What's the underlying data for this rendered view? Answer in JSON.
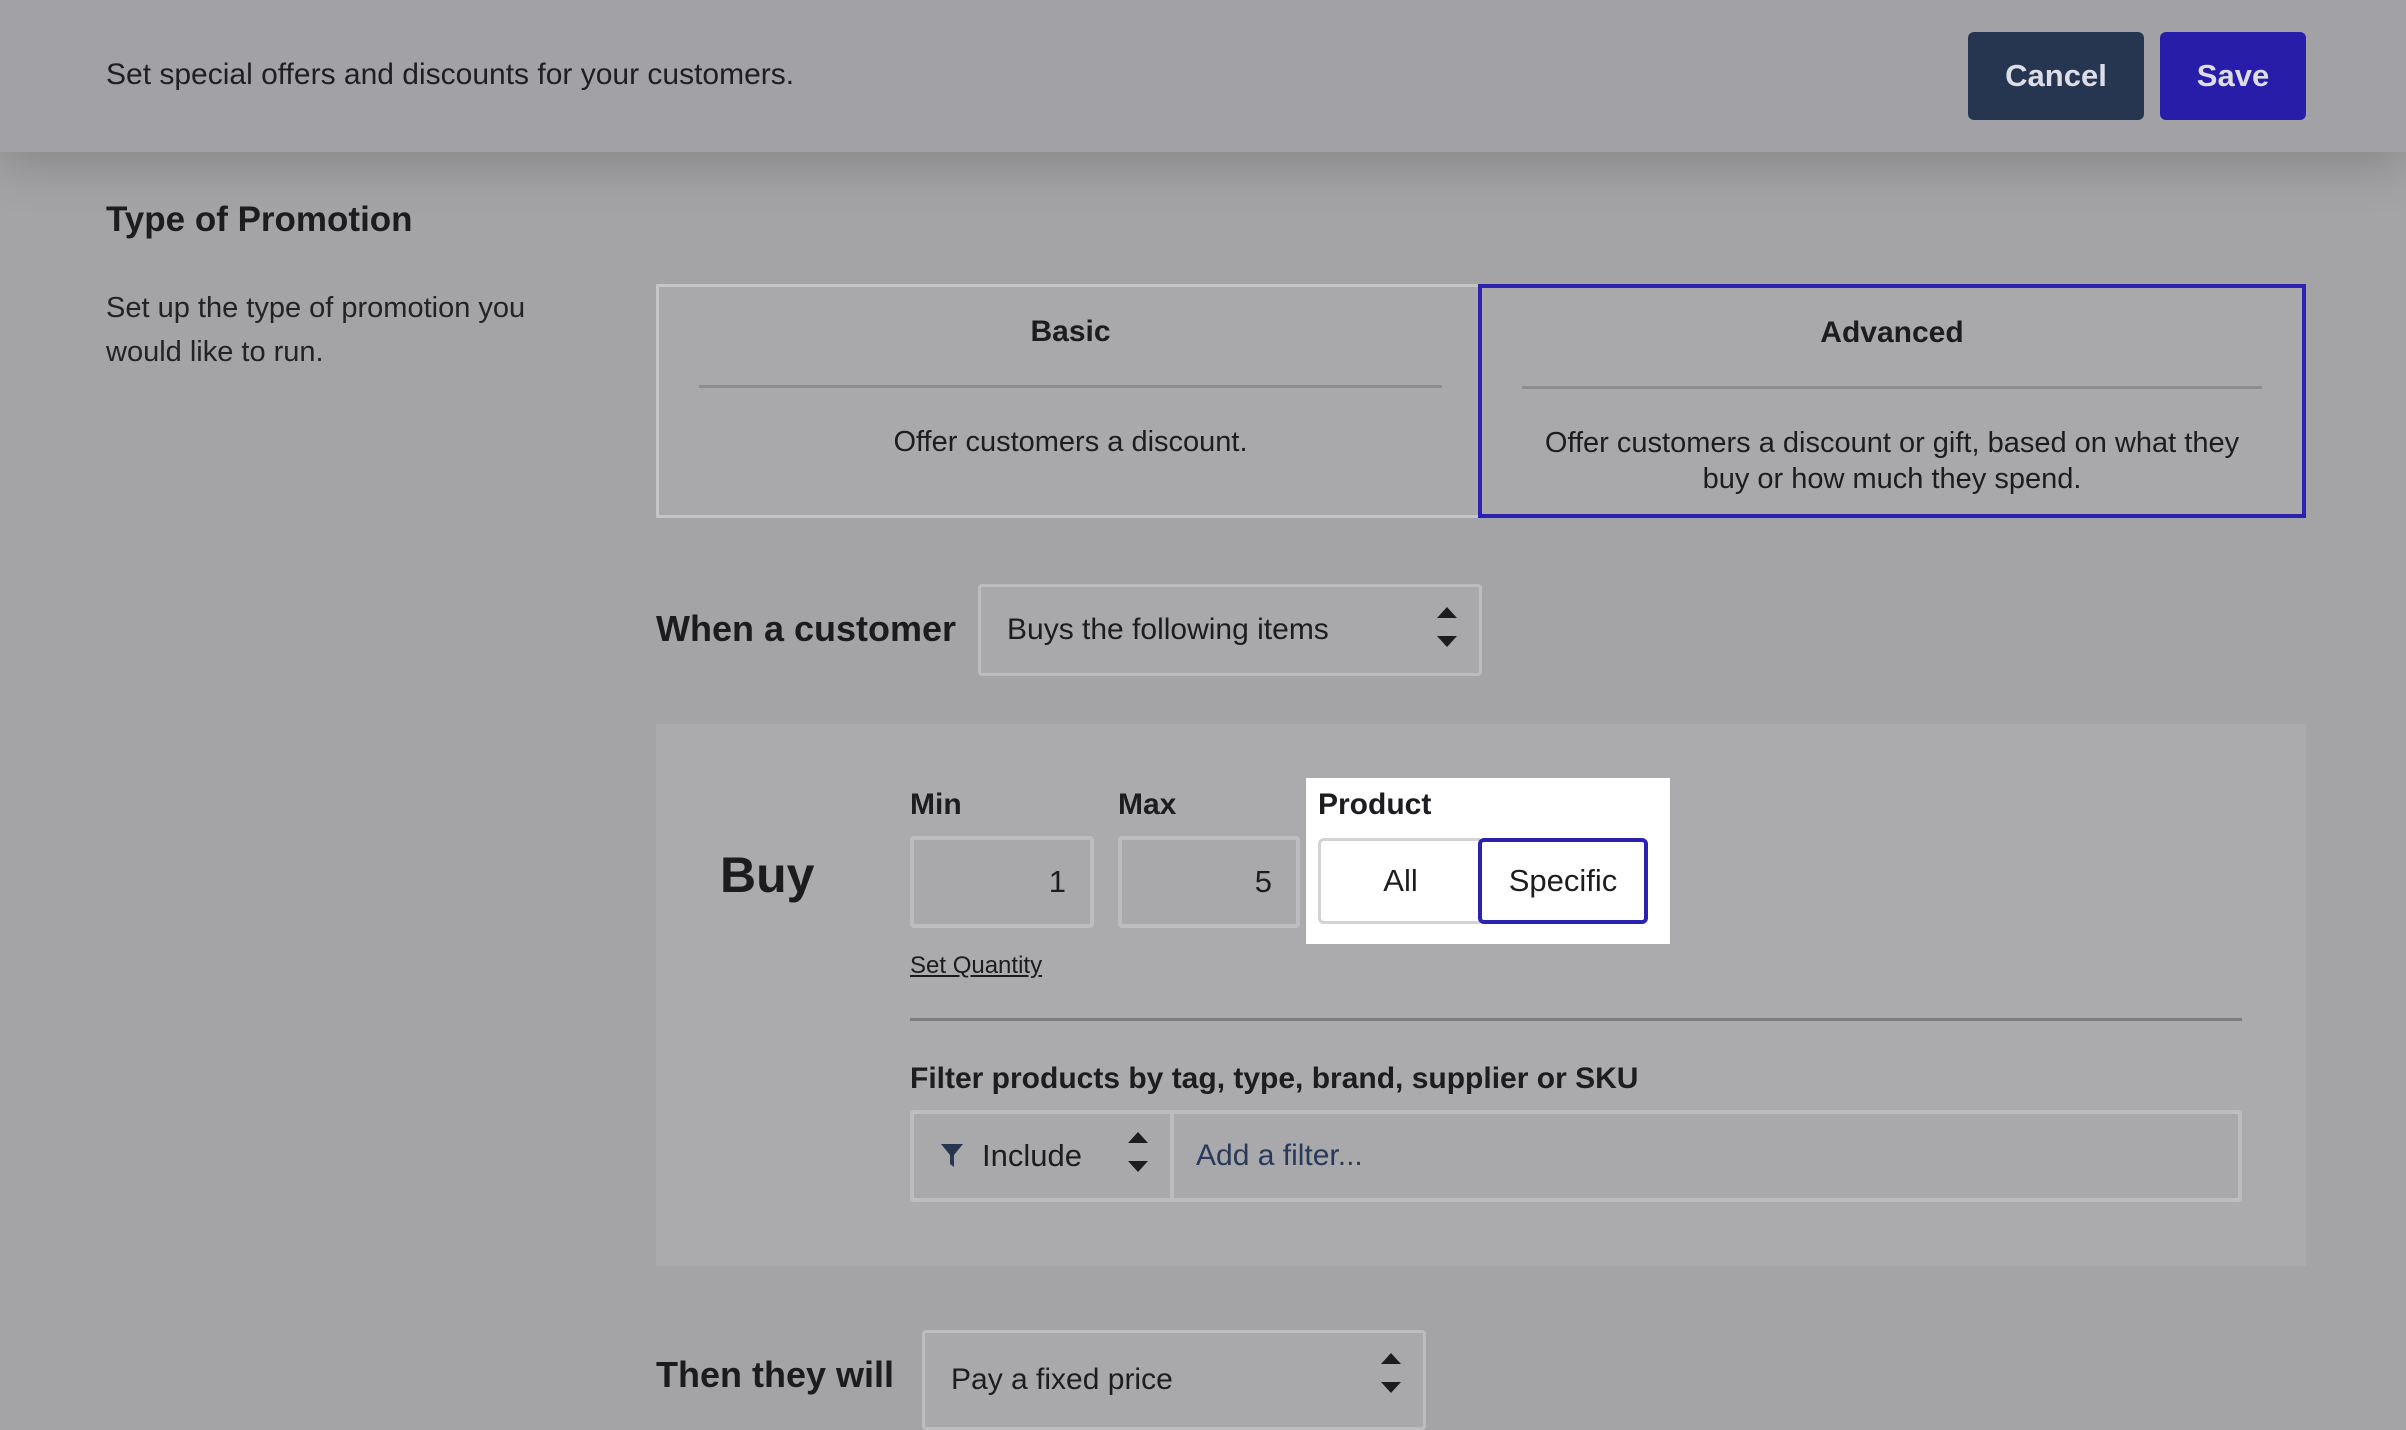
{
  "header": {
    "subtitle": "Set special offers and discounts for your customers.",
    "cancel_label": "Cancel",
    "save_label": "Save"
  },
  "promotion_type": {
    "title": "Type of Promotion",
    "description": "Set up the type of promotion you would like to run.",
    "options": [
      {
        "title": "Basic",
        "description": "Offer customers a discount.",
        "selected": false
      },
      {
        "title": "Advanced",
        "description": "Offer customers a discount or gift, based on what they buy or how much they spend.",
        "selected": true
      }
    ]
  },
  "condition": {
    "label": "When a customer",
    "selected": "Buys the following items"
  },
  "buy": {
    "title": "Buy",
    "min_label": "Min",
    "min_value": "1",
    "max_label": "Max",
    "max_value": "5",
    "product_label": "Product",
    "product_options": [
      "All",
      "Specific"
    ],
    "product_selected": "Specific",
    "set_quantity_link": "Set Quantity",
    "filter_label": "Filter products by tag, type, brand, supplier or SKU",
    "filter_mode": "Include",
    "filter_placeholder": "Add a filter..."
  },
  "action": {
    "label": "Then they will",
    "selected": "Pay a fixed price"
  },
  "colors": {
    "accent": "#2c22b0",
    "cancel_bg": "#263651",
    "save_bg": "#281da8",
    "overlay": "#a4a4a7"
  },
  "icons": [
    "funnel-icon",
    "updown-arrows-icon"
  ]
}
